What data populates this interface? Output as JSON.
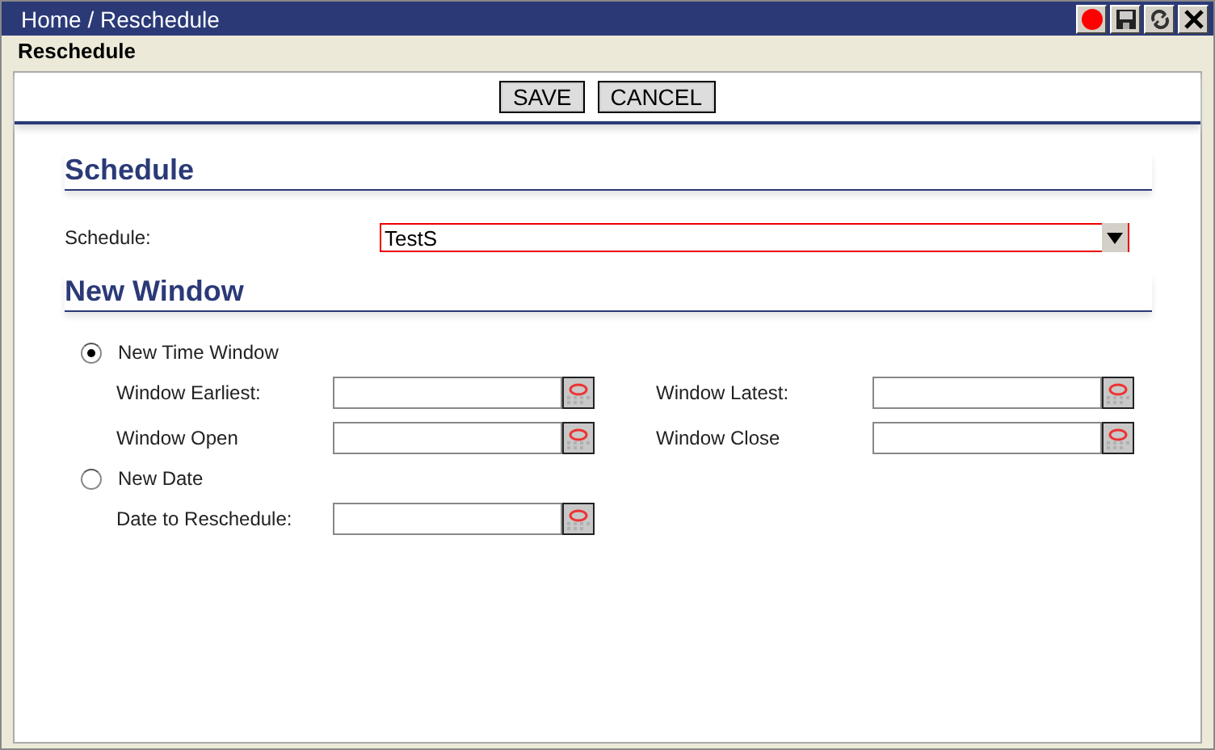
{
  "window": {
    "title": "Home / Reschedule",
    "subtitle": "Reschedule"
  },
  "title_buttons": [
    {
      "kind": "record"
    },
    {
      "kind": "save"
    },
    {
      "kind": "refresh"
    },
    {
      "kind": "close"
    }
  ],
  "toolbar": {
    "buttons": [
      "SAVE",
      "CANCEL"
    ]
  },
  "schedule_section": {
    "title": "Schedule",
    "label": "Schedule:",
    "value": "TestS"
  },
  "new_window_section": {
    "title": "New Window",
    "options": [
      {
        "label": "New Time Window",
        "selected": true,
        "fields": [
          {
            "label": "Window Earliest:"
          },
          {
            "label": "Window Latest:"
          },
          {
            "label": "Window Open"
          },
          {
            "label": "Window Close"
          }
        ]
      },
      {
        "label": "New Date",
        "selected": false,
        "fields": [
          {
            "label": "Date to Reschedule:"
          }
        ]
      }
    ]
  }
}
